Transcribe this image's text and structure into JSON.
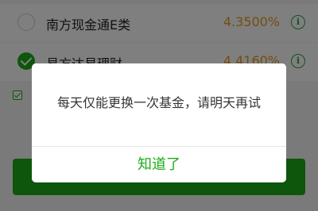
{
  "fund_list": [
    {
      "name": "南方现金通E类",
      "rate": "4.3500%",
      "selected": false
    },
    {
      "name": "易方达易理财",
      "rate": "4.4160%",
      "selected": true
    }
  ],
  "agreement": {
    "checked": true
  },
  "colors": {
    "accent": "#1aad19",
    "rate": "#e89b1f",
    "info_icon": "#2aa33a"
  },
  "dialog": {
    "message": "每天仅能更换一次基金，请明天再试",
    "button_label": "知道了"
  }
}
